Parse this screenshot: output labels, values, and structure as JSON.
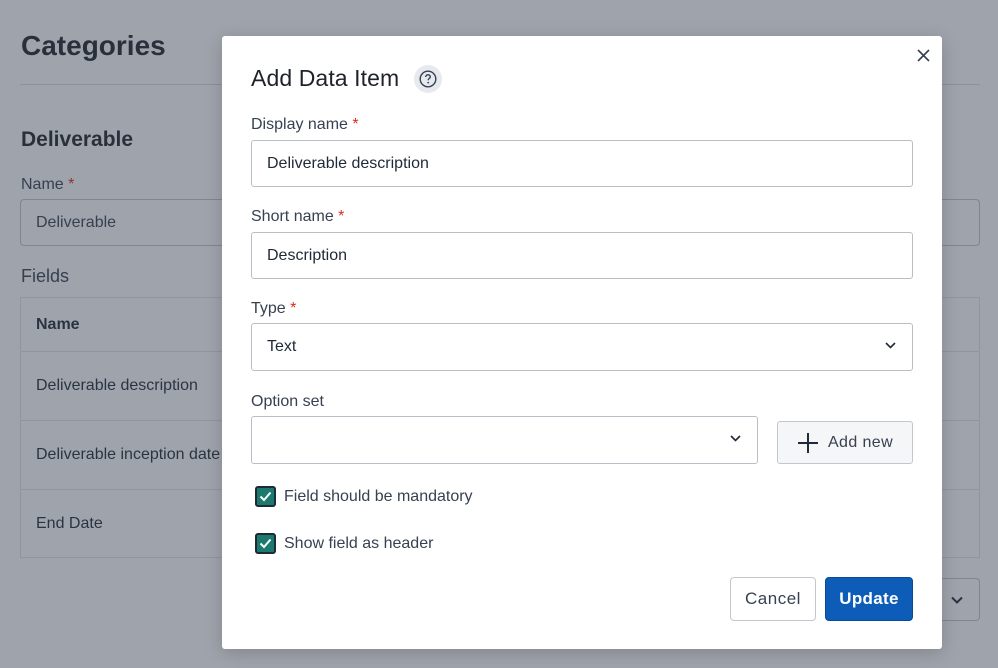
{
  "background": {
    "page_title": "Categories",
    "section_title": "Deliverable",
    "name_field": {
      "label": "Name",
      "required_mark": "*",
      "value": "Deliverable"
    },
    "fields_label": "Fields",
    "table": {
      "header": "Name",
      "rows": [
        "Deliverable description",
        "Deliverable inception date",
        "End Date"
      ]
    }
  },
  "modal": {
    "title": "Add Data Item",
    "display_name": {
      "label": "Display name",
      "required_mark": "*",
      "value": "Deliverable description"
    },
    "short_name": {
      "label": "Short name",
      "required_mark": "*",
      "value": "Description"
    },
    "type": {
      "label": "Type",
      "required_mark": "*",
      "value": "Text"
    },
    "option_set": {
      "label": "Option set",
      "value": ""
    },
    "add_new_label": "Add new",
    "mandatory": {
      "label": "Field should be mandatory",
      "checked": true
    },
    "show_header": {
      "label": "Show field as header",
      "checked": true
    },
    "cancel_label": "Cancel",
    "update_label": "Update"
  },
  "colors": {
    "primary": "#0d5cb8",
    "checkbox": "#1b7a6d",
    "required": "#d92d20",
    "overlay": "rgba(55,62,80,0.48)"
  },
  "icons": [
    "close-icon",
    "help-icon",
    "chevron-down-icon",
    "plus-icon",
    "check-icon"
  ]
}
